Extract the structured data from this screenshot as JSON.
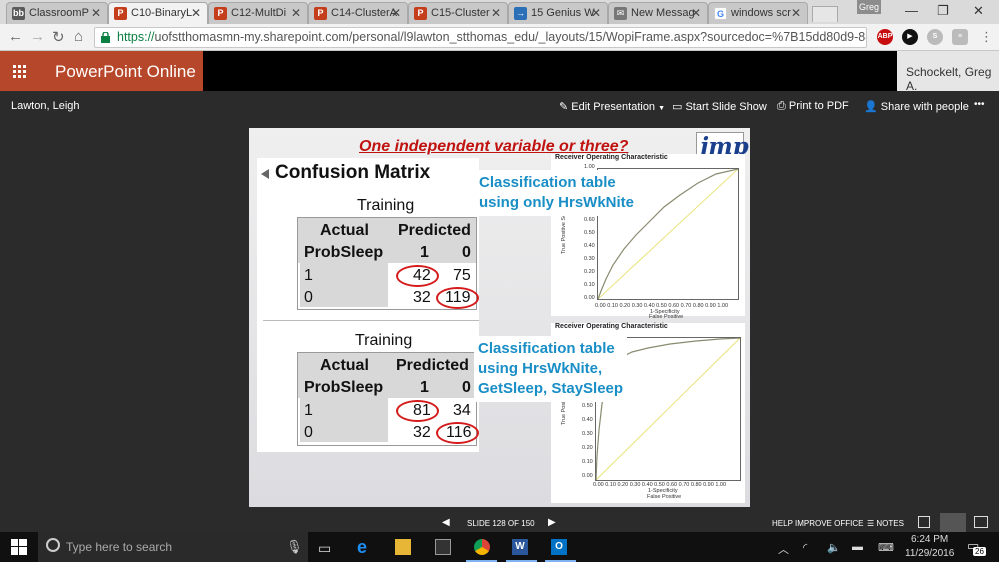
{
  "browser": {
    "tabs": [
      {
        "label": "ClassroomP",
        "icon": "bb",
        "color": "#5a5a5a"
      },
      {
        "label": "C10-BinaryL",
        "icon": "P",
        "color": "#c43e1c"
      },
      {
        "label": "C12-MultDi",
        "icon": "P",
        "color": "#c43e1c"
      },
      {
        "label": "C14-ClusterA",
        "icon": "P",
        "color": "#c43e1c"
      },
      {
        "label": "C15-Cluster",
        "icon": "P",
        "color": "#c43e1c"
      },
      {
        "label": "15 Genius W",
        "icon": "→",
        "color": "#2b6fb6"
      },
      {
        "label": "New Messag",
        "icon": "✉",
        "color": "#777777"
      },
      {
        "label": "windows scr",
        "icon": "G",
        "color": "#4285f4"
      }
    ],
    "profile": "Greg",
    "url_https": "https://",
    "url_rest": "uofstthomasmn-my.sharepoint.com/personal/l9lawton_stthomas_edu/_layouts/15/WopiFrame.aspx?sourcedoc=%7B15dd80d9-8876-4960-9cf0-3",
    "extensions": [
      "ABP",
      "▶",
      "S",
      "≡"
    ]
  },
  "office": {
    "app_name": "PowerPoint Online",
    "user": "Schockelt, Greg A.",
    "owner": "Lawton, Leigh",
    "edit": "Edit Presentation",
    "slideshow": "Start Slide Show",
    "pdf": "Print to PDF",
    "share": "Share with people",
    "more": "•••"
  },
  "slide": {
    "title": "One independent variable or three?",
    "logo": "jmp",
    "panel_title": "Confusion Matrix",
    "tables": [
      {
        "caption": "Training",
        "h_actual": "Actual",
        "h_predicted": "Predicted",
        "h_probsleep": "ProbSleep",
        "h_1": "1",
        "h_0": "0",
        "rows": [
          {
            "label": "1",
            "a": "42",
            "b": "75"
          },
          {
            "label": "0",
            "a": "32",
            "b": "119"
          }
        ]
      },
      {
        "caption": "Training",
        "h_actual": "Actual",
        "h_predicted": "Predicted",
        "h_probsleep": "ProbSleep",
        "h_1": "1",
        "h_0": "0",
        "rows": [
          {
            "label": "1",
            "a": "81",
            "b": "34"
          },
          {
            "label": "0",
            "a": "32",
            "b": "116"
          }
        ]
      }
    ],
    "callouts": [
      {
        "l1": "Classification table",
        "l2": "using only HrsWkNite"
      },
      {
        "l1": "Classification table",
        "l2": "using HrsWkNite,",
        "l3": "GetSleep, StaySleep"
      }
    ],
    "roc": [
      {
        "title": "Receiver Operating Characteristic",
        "ylabel": "True Positive Sensitivity",
        "xlabel": "1-Specificity",
        "xlabel2": "False Positive",
        "yticks": [
          "1.00",
          "0.60",
          "0.50",
          "0.40",
          "0.30",
          "0.20",
          "0.10",
          "0.00"
        ],
        "xticks": "0.00 0.10 0.20 0.30 0.40 0.50 0.60 0.70 0.80 0.90 1.00"
      },
      {
        "title": "Receiver Operating Characteristic",
        "ylabel": "True Posi Sensitiv",
        "xlabel": "1-Specificity",
        "xlabel2": "False Positive",
        "yticks": [
          "0.50",
          "0.40",
          "0.30",
          "0.20",
          "0.10",
          "0.00"
        ],
        "xticks": "0.00 0.10 0.20 0.30 0.40 0.50 0.60 0.70 0.80 0.90 1.00"
      }
    ]
  },
  "status": {
    "slide_info": "SLIDE 128 OF 150",
    "help": "HELP IMPROVE OFFICE",
    "notes": "NOTES"
  },
  "taskbar": {
    "search_placeholder": "Type here to search",
    "time": "6:24 PM",
    "date": "11/29/2016",
    "notif_count": "26"
  }
}
